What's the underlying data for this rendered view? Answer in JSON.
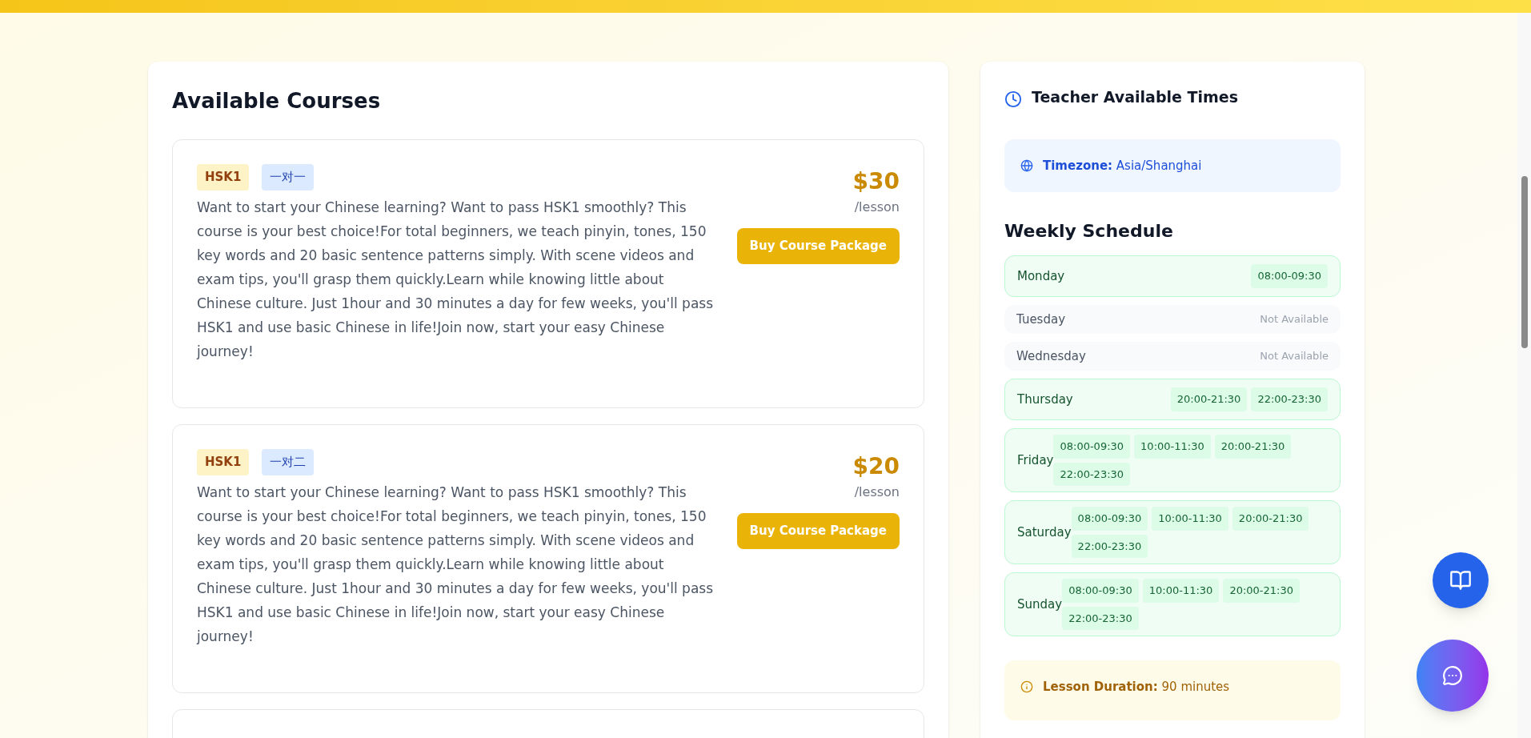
{
  "courses_panel": {
    "title": "Available Courses",
    "courses": [
      {
        "level_tag": "HSK1",
        "type_tag": "一对一",
        "description": "Want to start your Chinese learning? Want to pass HSK1 smoothly? This course is your best choice!For total beginners, we teach pinyin, tones, 150 key words and 20 basic sentence patterns simply. With scene videos and exam tips, you'll grasp them quickly.Learn while knowing little about Chinese culture. Just 1hour and 30 minutes a day for few weeks, you'll pass HSK1 and use basic Chinese in life!Join now, start your easy Chinese journey!",
        "price": "$30",
        "unit": "/lesson",
        "button": "Buy Course Package"
      },
      {
        "level_tag": "HSK1",
        "type_tag": "一对二",
        "description": "Want to start your Chinese learning? Want to pass HSK1 smoothly? This course is your best choice!For total beginners, we teach pinyin, tones, 150 key words and 20 basic sentence patterns simply. With scene videos and exam tips, you'll grasp them quickly.Learn while knowing little about Chinese culture. Just 1hour and 30 minutes a day for few weeks, you'll pass HSK1 and use basic Chinese in life!Join now, start your easy Chinese journey!",
        "price": "$20",
        "unit": "/lesson",
        "button": "Buy Course Package"
      }
    ]
  },
  "times_panel": {
    "title": "Teacher Available Times",
    "timezone_label": "Timezone:",
    "timezone": "Asia/Shanghai",
    "schedule_title": "Weekly Schedule",
    "days": [
      {
        "day": "Monday",
        "available": true,
        "slots": [
          "08:00-09:30"
        ]
      },
      {
        "day": "Tuesday",
        "available": false,
        "status": "Not Available"
      },
      {
        "day": "Wednesday",
        "available": false,
        "status": "Not Available"
      },
      {
        "day": "Thursday",
        "available": true,
        "slots": [
          "20:00-21:30",
          "22:00-23:30"
        ]
      },
      {
        "day": "Friday",
        "available": true,
        "slots": [
          "08:00-09:30",
          "10:00-11:30",
          "20:00-21:30",
          "22:00-23:30"
        ]
      },
      {
        "day": "Saturday",
        "available": true,
        "slots": [
          "08:00-09:30",
          "10:00-11:30",
          "20:00-21:30",
          "22:00-23:30"
        ]
      },
      {
        "day": "Sunday",
        "available": true,
        "slots": [
          "08:00-09:30",
          "10:00-11:30",
          "20:00-21:30",
          "22:00-23:30"
        ]
      }
    ],
    "duration_label": "Lesson Duration:",
    "duration": "90 minutes"
  }
}
